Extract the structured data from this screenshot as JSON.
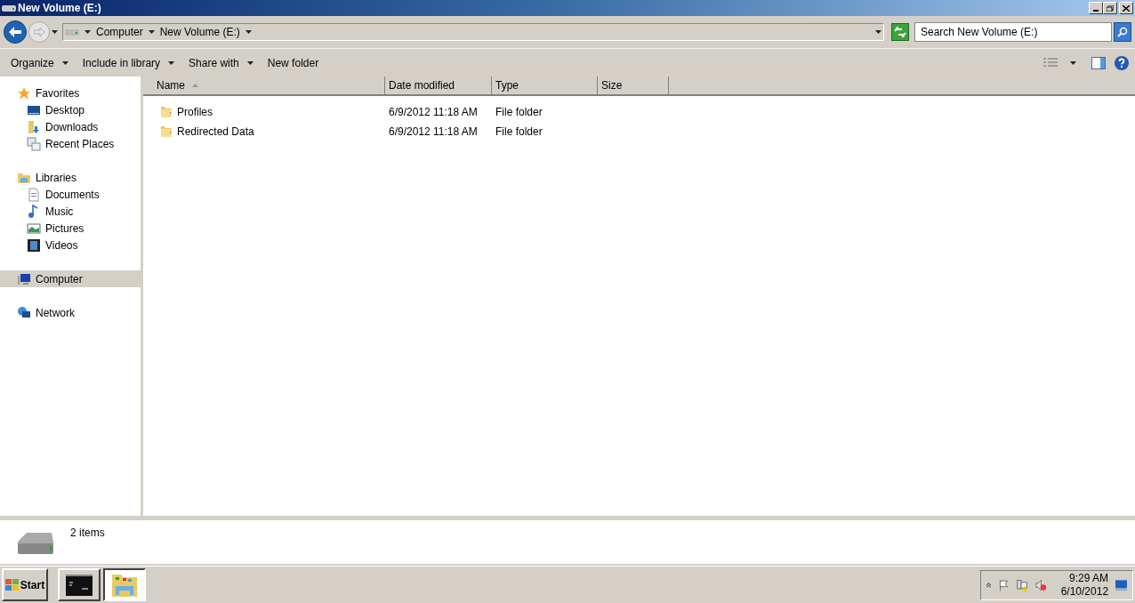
{
  "window": {
    "title": "New Volume (E:)"
  },
  "address": {
    "crumbs": [
      "Computer",
      "New Volume (E:)"
    ],
    "search_placeholder": "Search New Volume (E:)"
  },
  "toolbar": [
    {
      "label": "Organize",
      "dropdown": true
    },
    {
      "label": "Include in library",
      "dropdown": true
    },
    {
      "label": "Share with",
      "dropdown": true
    },
    {
      "label": "New folder",
      "dropdown": false
    }
  ],
  "sidebar": {
    "groups": [
      {
        "label": "Favorites",
        "kind": "star",
        "selected": false,
        "children": [
          {
            "label": "Desktop",
            "kind": "desktop",
            "selected": false
          },
          {
            "label": "Downloads",
            "kind": "downloads",
            "selected": false
          },
          {
            "label": "Recent Places",
            "kind": "recent",
            "selected": false
          }
        ]
      },
      {
        "label": "Libraries",
        "kind": "library",
        "selected": false,
        "children": [
          {
            "label": "Documents",
            "kind": "document",
            "selected": false
          },
          {
            "label": "Music",
            "kind": "music",
            "selected": false
          },
          {
            "label": "Pictures",
            "kind": "pictures",
            "selected": false
          },
          {
            "label": "Videos",
            "kind": "videos",
            "selected": false
          }
        ]
      },
      {
        "label": "Computer",
        "kind": "computer",
        "selected": true
      },
      {
        "label": "Network",
        "kind": "network",
        "selected": false
      }
    ]
  },
  "table": {
    "columns": [
      {
        "label": "Name",
        "sorted": true
      },
      {
        "label": "Date modified",
        "sorted": false
      },
      {
        "label": "Type",
        "sorted": false
      },
      {
        "label": "Size",
        "sorted": false
      }
    ],
    "rows": [
      {
        "name": "Profiles",
        "date": "6/9/2012 11:18 AM",
        "type": "File folder"
      },
      {
        "name": "Redirected Data",
        "date": "6/9/2012 11:18 AM",
        "type": "File folder"
      }
    ]
  },
  "details": {
    "count": "2 items"
  },
  "taskbar": {
    "start": "Start",
    "tasks": [
      {
        "kind": "console",
        "selected": false
      },
      {
        "kind": "explorer",
        "selected": true
      }
    ],
    "time": "9:29 AM",
    "date": "6/10/2012"
  }
}
